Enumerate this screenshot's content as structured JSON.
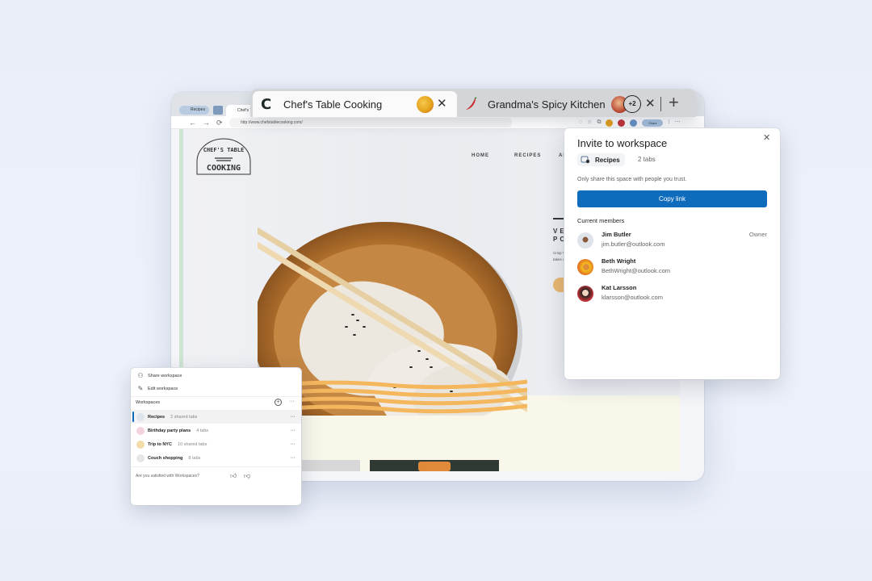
{
  "browser": {
    "tabs": [
      {
        "title": "Chef's Table Cooking",
        "icon": "chefs-table-c-logo",
        "icon_glyph": "C",
        "active": true
      },
      {
        "title": "Grandma's Spicy Kitchen",
        "icon": "chili-pepper-icon",
        "active": false,
        "extra_collaborators": "+2"
      }
    ],
    "close_glyph": "✕",
    "new_tab_glyph": "+",
    "mini_tabs": {
      "workspace_label": "Recipes",
      "tab_label": "Chef's Ta"
    },
    "url": "http://www.chefstablecooking.com/",
    "toolbar_pill": "Share",
    "nav": {
      "back": "←",
      "forward": "→",
      "refresh": "⟳"
    }
  },
  "site": {
    "logo_top": "CHEF'S TABLE",
    "logo_bottom": "COOKING",
    "nav": [
      "HOME",
      "RECIPES",
      "AB"
    ],
    "hero_title": "VE PO",
    "hero_body": "Crisp These takes want"
  },
  "invite": {
    "title": "Invite to workspace",
    "close_glyph": "✕",
    "workspace_name": "Recipes",
    "tab_count": "2 tabs",
    "note": "Only share this space with people you trust.",
    "copy_button": "Copy link",
    "members_heading": "Current members",
    "members": [
      {
        "name": "Jim Butler",
        "email": "jim.butler@outlook.com",
        "role": "Owner",
        "avatar_color": "#dfe3ea"
      },
      {
        "name": "Beth Wright",
        "email": "BethWright@outlook.com",
        "role": "",
        "avatar_color": "#f3c21b"
      },
      {
        "name": "Kat Larsson",
        "email": "klarsson@outlook.com",
        "role": "",
        "avatar_color": "#c8343a"
      }
    ]
  },
  "workspaces_panel": {
    "share": "Share workspace",
    "edit": "Edit workspace",
    "heading": "Workspaces",
    "add_glyph": "+",
    "more_glyph": "···",
    "items": [
      {
        "name": "Recipes",
        "count": "2 shared tabs",
        "selected": true
      },
      {
        "name": "Birthday party plans",
        "count": "4 tabs",
        "selected": false
      },
      {
        "name": "Trip to NYC",
        "count": "10 shared tabs",
        "selected": false
      },
      {
        "name": "Couch shopping",
        "count": "8 tabs",
        "selected": false
      }
    ],
    "feedback_question": "Are you satisfied with Workspaces?",
    "thumbs_up": "👍",
    "thumbs_down": "👎"
  },
  "colors": {
    "accent": "#0f6cbd",
    "hero_button": "#e9b870",
    "noodle": "#f5b75e"
  }
}
